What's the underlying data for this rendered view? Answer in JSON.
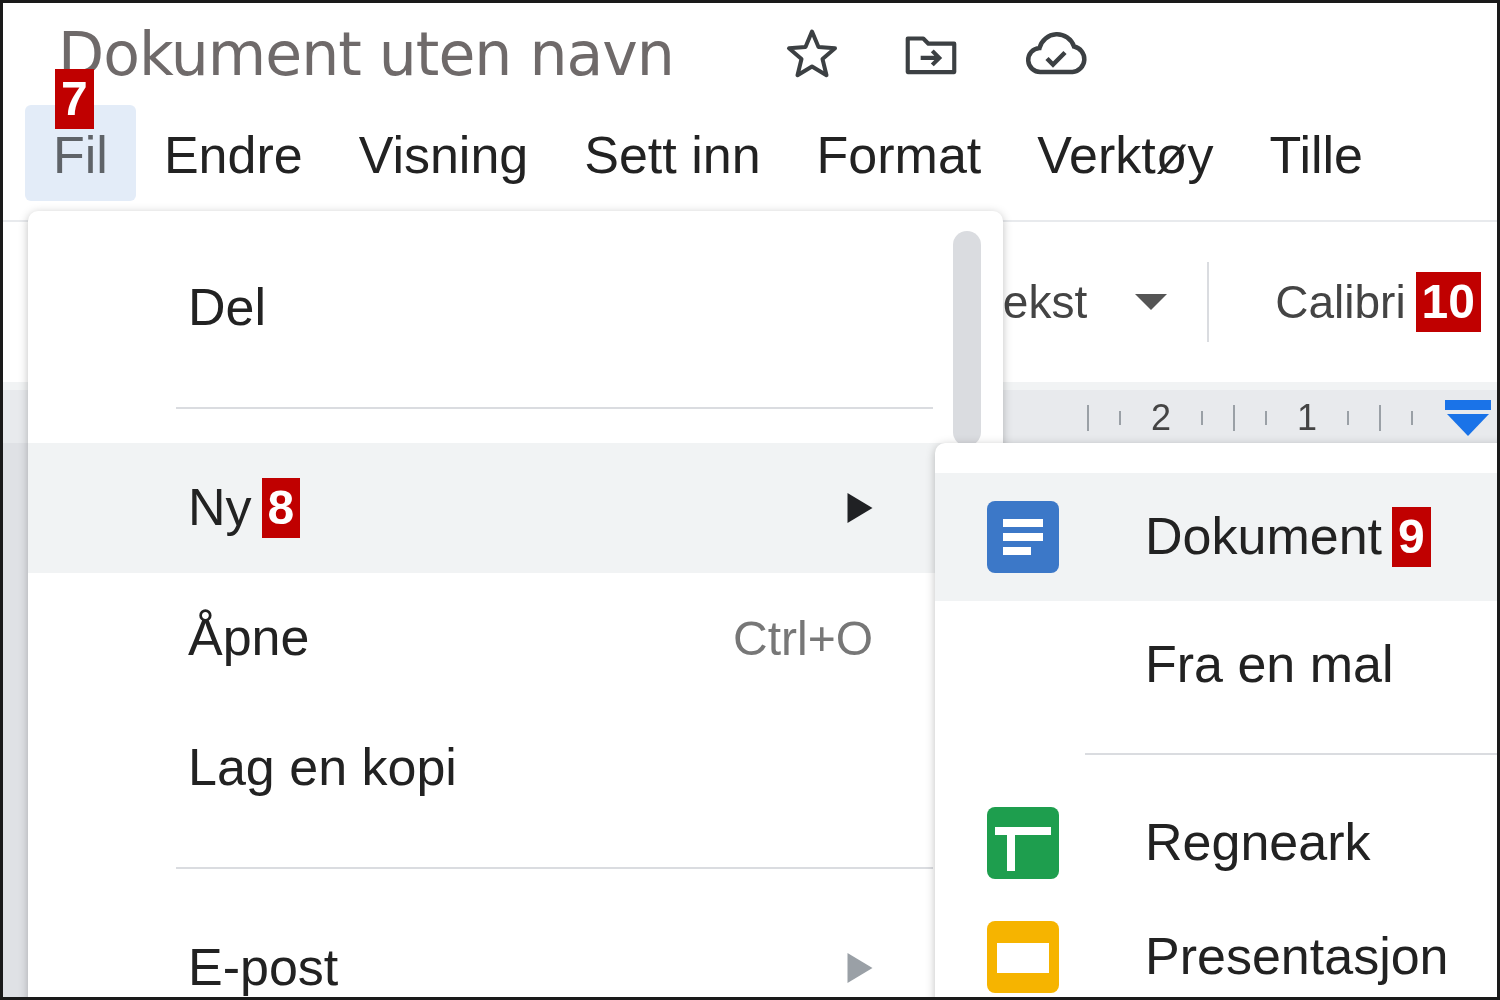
{
  "document": {
    "title": "Dokument uten navn"
  },
  "menu_bar": [
    {
      "label": "Fil",
      "selected": true,
      "badge": "7"
    },
    {
      "label": "Endre",
      "selected": false
    },
    {
      "label": "Visning",
      "selected": false
    },
    {
      "label": "Sett inn",
      "selected": false
    },
    {
      "label": "Format",
      "selected": false
    },
    {
      "label": "Verktøy",
      "selected": false
    },
    {
      "label": "Tille",
      "selected": false
    }
  ],
  "toolbar": {
    "style": "ekst",
    "font": "Calibri",
    "font_badge": "10"
  },
  "ruler": {
    "labels": [
      "2",
      "1"
    ]
  },
  "file_menu": {
    "items": [
      {
        "kind": "item",
        "label": "Del",
        "selected": false
      },
      {
        "kind": "separator"
      },
      {
        "kind": "item",
        "label": "Ny",
        "selected": true,
        "submenu": true,
        "badge": "8"
      },
      {
        "kind": "item",
        "label": "Åpne",
        "selected": false,
        "shortcut": "Ctrl+O"
      },
      {
        "kind": "item",
        "label": "Lag en kopi",
        "selected": false
      },
      {
        "kind": "separator"
      },
      {
        "kind": "item",
        "label": "E-post",
        "selected": false,
        "submenu": true
      }
    ]
  },
  "new_submenu": {
    "items": [
      {
        "kind": "item",
        "label": "Dokument",
        "selected": true,
        "badge": "9"
      },
      {
        "kind": "item",
        "label": "Fra en mal",
        "selected": false
      },
      {
        "kind": "separator"
      },
      {
        "kind": "item",
        "label": "Regneark",
        "selected": false
      },
      {
        "kind": "item",
        "label": "Presentasjon",
        "selected": false
      }
    ]
  }
}
